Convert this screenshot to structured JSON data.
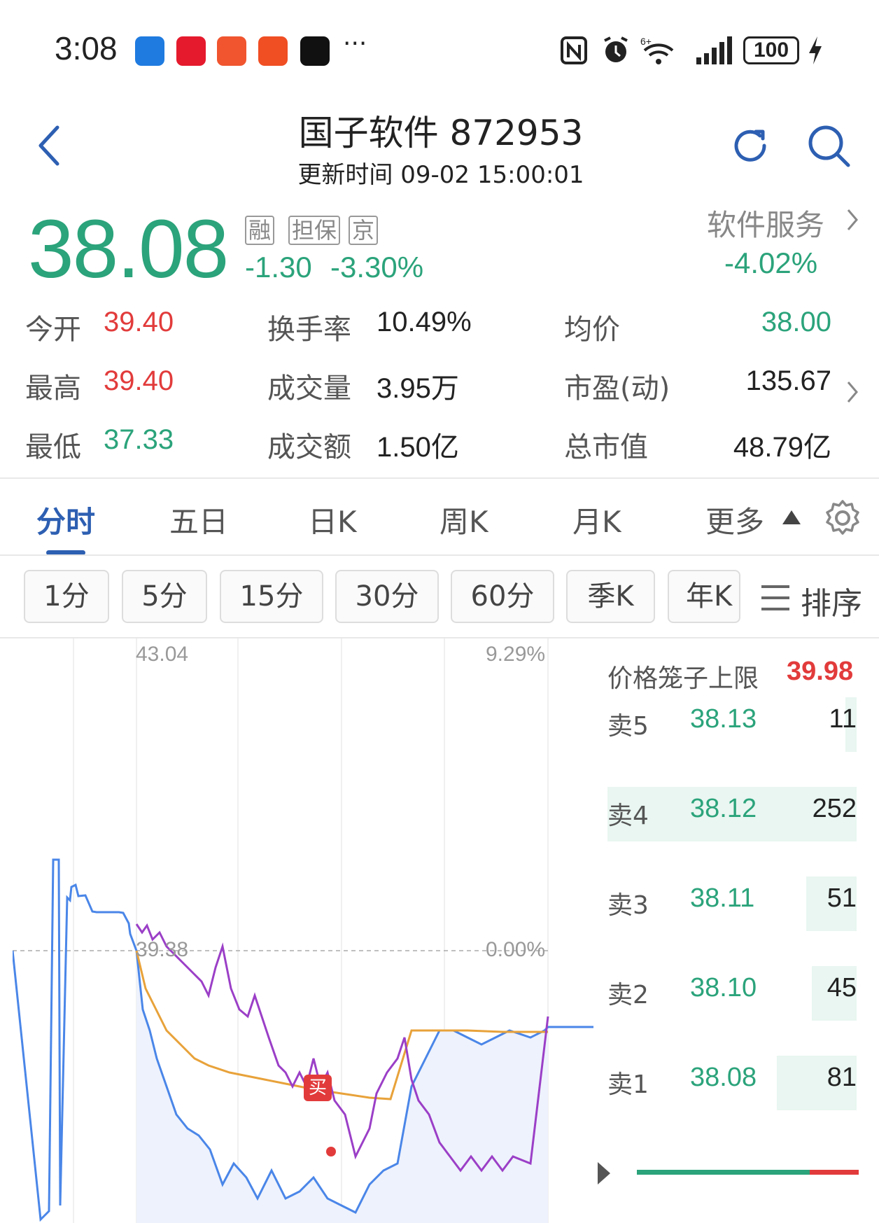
{
  "status": {
    "time": "3:08",
    "more": "···",
    "battery": "100"
  },
  "header": {
    "title": "国子软件 872953",
    "update_time": "更新时间 09-02 15:00:01"
  },
  "quote": {
    "price": "38.08",
    "tags": [
      "融",
      "担保",
      "京"
    ],
    "change": "-1.30",
    "change_pct": "-3.30%",
    "sector": "软件服务",
    "sector_change": "-4.02%"
  },
  "stats": [
    {
      "label": "今开",
      "value": "39.40",
      "color": "#e23b3b"
    },
    {
      "label": "换手率",
      "value": "10.49%",
      "color": "#222222"
    },
    {
      "label": "均价",
      "value": "38.00",
      "color": "#2ba37b"
    },
    {
      "label": "最高",
      "value": "39.40",
      "color": "#e23b3b"
    },
    {
      "label": "成交量",
      "value": "3.95万",
      "color": "#222222"
    },
    {
      "label": "市盈(动)",
      "value": "135.67",
      "color": "#222222"
    },
    {
      "label": "最低",
      "value": "37.33",
      "color": "#2ba37b"
    },
    {
      "label": "成交额",
      "value": "1.50亿",
      "color": "#222222"
    },
    {
      "label": "总市值",
      "value": "48.79亿",
      "color": "#222222"
    }
  ],
  "tabs": [
    "分时",
    "五日",
    "日K",
    "周K",
    "月K",
    "更多"
  ],
  "periods": [
    "1分",
    "5分",
    "15分",
    "30分",
    "60分",
    "季K",
    "年K"
  ],
  "sort_label": "排序",
  "chart": {
    "top_price": "43.04",
    "top_pct": "9.29%",
    "mid_price": "39.38",
    "mid_pct": "0.00%",
    "buy_marker": "买"
  },
  "order_book": {
    "cage_label": "价格笼子上限",
    "cage_value": "39.98",
    "asks": [
      {
        "label": "卖5",
        "price": "38.13",
        "volume": "11"
      },
      {
        "label": "卖4",
        "price": "38.12",
        "volume": "252"
      },
      {
        "label": "卖3",
        "price": "38.11",
        "volume": "51"
      },
      {
        "label": "卖2",
        "price": "38.10",
        "volume": "45"
      },
      {
        "label": "卖1",
        "price": "38.08",
        "volume": "81"
      }
    ]
  },
  "colors": {
    "up": "#e23b3b",
    "down": "#2ba37b",
    "accent": "#2d5fb2",
    "price_line": "#4a86e8",
    "avg_line": "#e8a23a",
    "other_line": "#9b3fc7"
  }
}
